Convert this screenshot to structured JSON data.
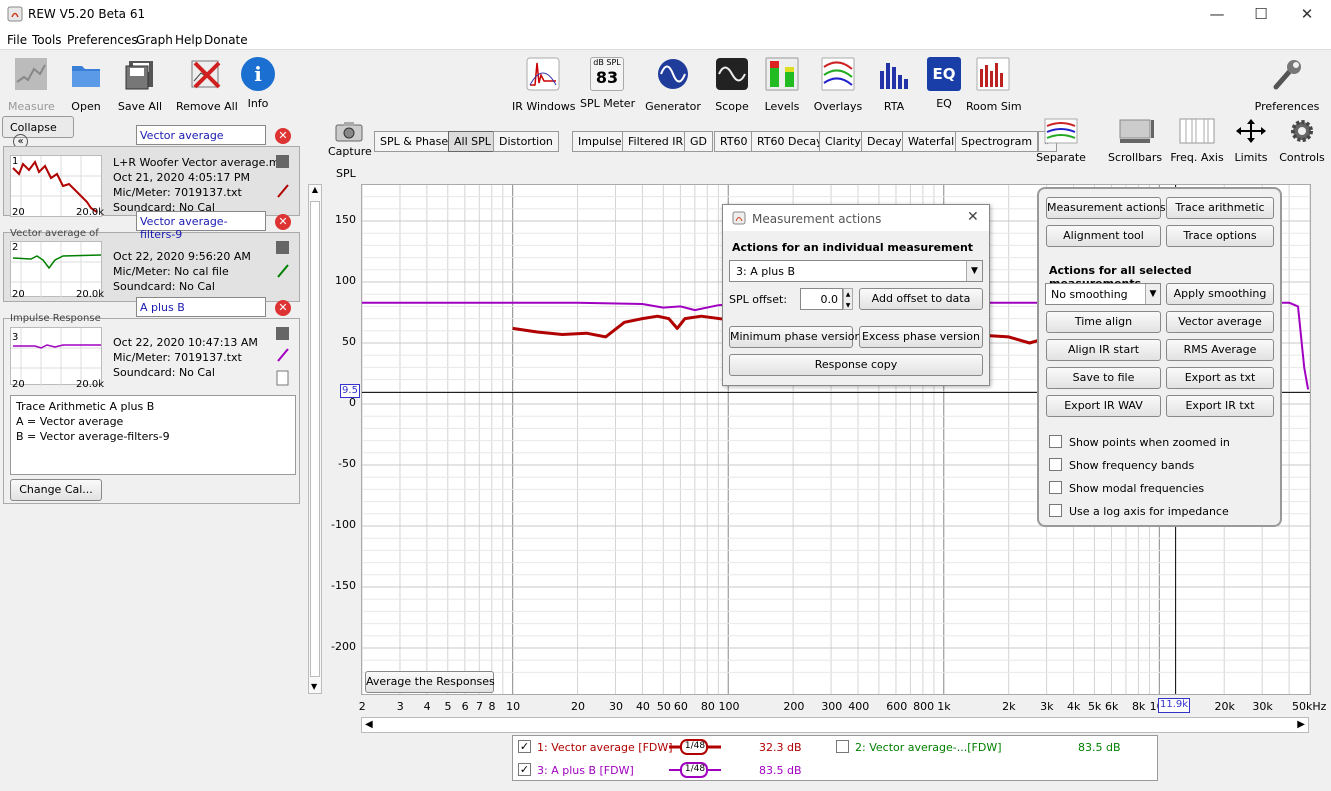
{
  "window": {
    "title": "REW V5.20 Beta 61",
    "minimize": "—",
    "maximize": "☐",
    "close": "✕"
  },
  "menu": [
    "File",
    "Tools",
    "Preferences",
    "Graph",
    "Help",
    "Donate"
  ],
  "toolbar_left": [
    {
      "label": "Measure",
      "icon": "measure-icon"
    },
    {
      "label": "Open",
      "icon": "folder-icon"
    },
    {
      "label": "Save All",
      "icon": "floppy-icon"
    },
    {
      "label": "Remove All",
      "icon": "remove-all-icon"
    },
    {
      "label": "Info",
      "icon": "info-icon",
      "glyph": "i"
    }
  ],
  "toolbar_center": [
    {
      "label": "IR Windows",
      "icon": "ir-windows-icon"
    },
    {
      "label": "SPL Meter",
      "icon": "spl-meter-icon",
      "top": "dB SPL",
      "value": "83"
    },
    {
      "label": "Generator",
      "icon": "generator-icon"
    },
    {
      "label": "Scope",
      "icon": "scope-icon"
    },
    {
      "label": "Levels",
      "icon": "levels-icon"
    },
    {
      "label": "Overlays",
      "icon": "overlays-icon"
    },
    {
      "label": "RTA",
      "icon": "rta-icon"
    },
    {
      "label": "EQ",
      "icon": "eq-icon",
      "glyph": "EQ"
    },
    {
      "label": "Room Sim",
      "icon": "room-sim-icon"
    }
  ],
  "toolbar_right": {
    "label": "Preferences",
    "icon": "wrench-icon"
  },
  "collapse": {
    "label": "Collapse",
    "glyph": "«"
  },
  "measurements": [
    {
      "num": "1",
      "name": "Vector average",
      "title": "L+R Woofer Vector average.md",
      "date": "Oct 21, 2020 4:05:17 PM",
      "mic": "Mic/Meter: 7019137.txt",
      "soundcard": "Soundcard: No Cal",
      "color": "#b00000",
      "thumb_lo": "20",
      "thumb_hi": "20.0k",
      "below": "Vector average of"
    },
    {
      "num": "2",
      "name": "Vector average-filters-9",
      "title": "",
      "date": "Oct 22, 2020 9:56:20 AM",
      "mic": "Mic/Meter: No cal file",
      "soundcard": "Soundcard: No Cal",
      "color": "#008000",
      "thumb_lo": "20",
      "thumb_hi": "20.0k",
      "below": "Impulse Response"
    },
    {
      "num": "3",
      "name": "A plus B",
      "title": "",
      "date": "Oct 22, 2020 10:47:13 AM",
      "mic": "Mic/Meter: 7019137.txt",
      "soundcard": "Soundcard: No Cal",
      "color": "#a000c0",
      "thumb_lo": "20",
      "thumb_hi": "20.0k"
    }
  ],
  "notes": [
    "Trace Arithmetic A plus B",
    "A = Vector average",
    "B = Vector average-filters-9"
  ],
  "change_cal": "Change Cal...",
  "capture": {
    "label": "Capture",
    "icon": "camera-icon"
  },
  "tabs": [
    "SPL & Phase",
    "All SPL",
    "Distortion",
    "Impulse",
    "Filtered IR",
    "GD",
    "RT60",
    "RT60 Decay",
    "Clarity",
    "Decay",
    "Waterfall",
    "Spectrogram",
    "»"
  ],
  "selected_tab": "All SPL",
  "graph_tools": [
    {
      "label": "Separate",
      "icon": "separate-icon"
    },
    {
      "label": "Scrollbars",
      "icon": "scrollbars-icon"
    },
    {
      "label": "Freq. Axis",
      "icon": "freq-axis-icon"
    },
    {
      "label": "Limits",
      "icon": "limits-icon"
    },
    {
      "label": "Controls",
      "icon": "gear-icon"
    }
  ],
  "y_unit": "SPL",
  "y_ticks": [
    "150",
    "100",
    "50",
    "0",
    "-50",
    "-100",
    "-150",
    "-200"
  ],
  "y_marker": "9.5",
  "x_ticks": [
    "2",
    "3",
    "4",
    "5",
    "6",
    "7",
    "8",
    "10",
    "20",
    "30",
    "40",
    "50",
    "60",
    "80",
    "100",
    "200",
    "300",
    "400",
    "600",
    "800",
    "1k",
    "2k",
    "3k",
    "4k",
    "5k",
    "6k",
    "8k",
    "10k",
    "20k",
    "30k",
    "50kHz"
  ],
  "x_cursor": "11.9k",
  "average_button": "Average the Responses",
  "dialog": {
    "title": "Measurement actions",
    "heading": "Actions for an individual measurement",
    "select": "3: A plus B",
    "offset_label": "SPL offset:",
    "offset_value": "0.0",
    "add_offset": "Add offset to data",
    "min_phase": "Minimum phase version",
    "excess_phase": "Excess phase version",
    "response_copy": "Response copy"
  },
  "controls": {
    "measurement_actions": "Measurement actions",
    "trace_arithmetic": "Trace arithmetic",
    "alignment_tool": "Alignment tool",
    "trace_options": "Trace options",
    "heading": "Actions for all selected measurements",
    "smoothing": "No  smoothing",
    "apply_smoothing": "Apply smoothing",
    "time_align": "Time align",
    "vector_average": "Vector average",
    "align_ir": "Align IR start",
    "rms_average": "RMS Average",
    "save_file": "Save to file",
    "export_txt": "Export as txt",
    "export_wav": "Export IR WAV",
    "export_irtxt": "Export IR txt",
    "checks": [
      "Show points when zoomed in",
      "Show frequency bands",
      "Show modal frequencies",
      "Use a log axis for impedance"
    ]
  },
  "legend": [
    {
      "label": "1: Vector average [FDW]",
      "smoothing": "1/48",
      "value": "32.3 dB",
      "color": "#b00000",
      "checked": true
    },
    {
      "label": "2: Vector average-...[FDW]",
      "value": "83.5 dB",
      "color": "#008000",
      "checked": false
    },
    {
      "label": "3: A plus B [FDW]",
      "smoothing": "1/48",
      "value": "83.5 dB",
      "color": "#a000c0",
      "checked": true
    }
  ],
  "chart_data": {
    "type": "line",
    "xscale": "log",
    "xlim": [
      2,
      50000
    ],
    "ylim": [
      -225,
      170
    ],
    "ylabel": "SPL",
    "series": [
      {
        "name": "1: Vector average [FDW]",
        "color": "#b00000",
        "points": [
          [
            10,
            62
          ],
          [
            13,
            59
          ],
          [
            17,
            57
          ],
          [
            22,
            58
          ],
          [
            27,
            55
          ],
          [
            33,
            67
          ],
          [
            40,
            70
          ],
          [
            47,
            72
          ],
          [
            53,
            70
          ],
          [
            58,
            62
          ],
          [
            63,
            70
          ],
          [
            75,
            72
          ],
          [
            100,
            69
          ],
          [
            2000,
            55
          ],
          [
            2500,
            50
          ],
          [
            3000,
            54
          ],
          [
            4000,
            48
          ],
          [
            5000,
            40
          ],
          [
            6000,
            44
          ],
          [
            7000,
            38
          ]
        ]
      },
      {
        "name": "3: A plus B [FDW]",
        "color": "#a000c0",
        "points": [
          [
            2,
            83
          ],
          [
            20,
            83
          ],
          [
            40,
            82
          ],
          [
            50,
            79
          ],
          [
            60,
            80
          ],
          [
            70,
            77
          ],
          [
            90,
            81
          ],
          [
            120,
            83
          ],
          [
            1000,
            83
          ],
          [
            20000,
            83
          ],
          [
            40000,
            83
          ],
          [
            44000,
            80
          ],
          [
            47000,
            30
          ],
          [
            49000,
            12
          ]
        ]
      }
    ]
  }
}
